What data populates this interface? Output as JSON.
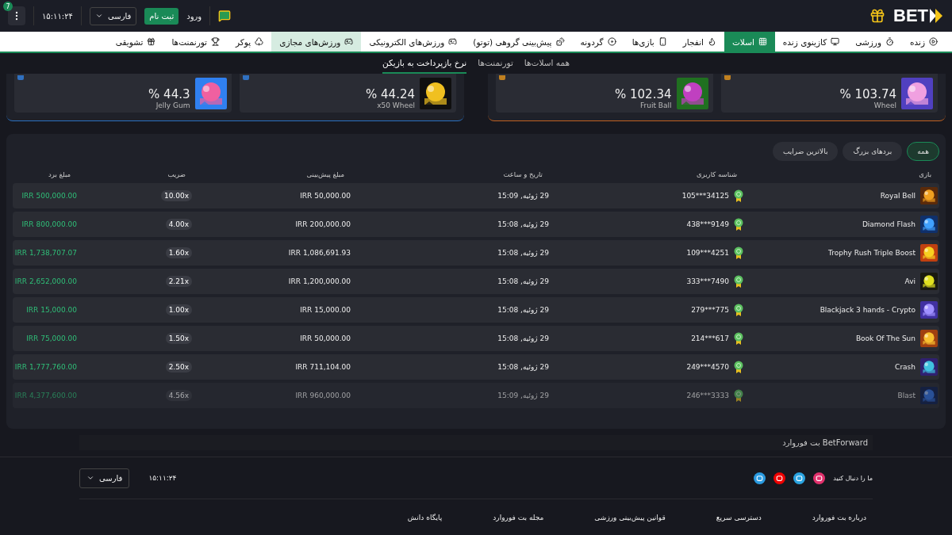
{
  "header": {
    "logo": "BET",
    "login": "ورود",
    "signup": "ثبت نام",
    "language": "فارسی",
    "time": "۱۵:۱۱:۲۴",
    "menu_badge": "7"
  },
  "nav": [
    {
      "label": "زنده",
      "selected": false,
      "hover": false
    },
    {
      "label": "ورزشی",
      "selected": false,
      "hover": false
    },
    {
      "label": "کازینوی زنده",
      "selected": false,
      "hover": false
    },
    {
      "label": "اسلات",
      "selected": true,
      "hover": false
    },
    {
      "label": "انفجار",
      "selected": false,
      "hover": false
    },
    {
      "label": "بازی‌ها",
      "selected": false,
      "hover": false
    },
    {
      "label": "گردونه",
      "selected": false,
      "hover": false
    },
    {
      "label": "پیش‌بینی گروهی (توتو)",
      "selected": false,
      "hover": false
    },
    {
      "label": "ورزش‌های الکترونیکی",
      "selected": false,
      "hover": false
    },
    {
      "label": "ورزش‌های مجازی",
      "selected": false,
      "hover": true
    },
    {
      "label": "پوکر",
      "selected": false,
      "hover": false
    },
    {
      "label": "تورنمنت‌ها",
      "selected": false,
      "hover": false
    },
    {
      "label": "تشویقی",
      "selected": false,
      "hover": false
    }
  ],
  "subtabs": [
    {
      "label": "همه اسلات‌ها",
      "selected": false
    },
    {
      "label": "تورنمنت‌ها",
      "selected": false
    },
    {
      "label": "نرخ بازپرداخت به بازیکن",
      "selected": true
    }
  ],
  "rtp_groups": [
    {
      "cards": [
        {
          "name": "Wheel",
          "rtp": "% 103.74"
        },
        {
          "name": "Fruit Ball",
          "rtp": "% 102.34"
        }
      ]
    },
    {
      "cards": [
        {
          "name": "x50 Wheel",
          "rtp": "% 44.24"
        },
        {
          "name": "Jelly Gum",
          "rtp": "% 44.3"
        }
      ]
    }
  ],
  "filters": [
    {
      "label": "همه",
      "selected": true
    },
    {
      "label": "بردهای بزرگ",
      "selected": false
    },
    {
      "label": "بالاترین ضرایب",
      "selected": false
    }
  ],
  "table": {
    "columns": [
      "بازی",
      "شناسه کاربری",
      "تاریخ و ساعت",
      "مبلغ پیش‌بینی",
      "ضریب",
      "مبلغ برد"
    ],
    "rows": [
      {
        "game": "Royal Bell",
        "user": "34125***105",
        "date": "29 ژوئیه, 15:09",
        "bet": "IRR 50,000.00",
        "multiplier": "10.00x",
        "win": "IRR 500,000.00",
        "faded": false
      },
      {
        "game": "Diamond Flash",
        "user": "9149***438",
        "date": "29 ژوئیه, 15:08",
        "bet": "IRR 200,000.00",
        "multiplier": "4.00x",
        "win": "IRR 800,000.00",
        "faded": false
      },
      {
        "game": "Trophy Rush Triple Boost",
        "user": "4251***109",
        "date": "29 ژوئیه, 15:08",
        "bet": "IRR 1,086,691.93",
        "multiplier": "1.60x",
        "win": "IRR 1,738,707.07",
        "faded": false
      },
      {
        "game": "Avi",
        "user": "7490***333",
        "date": "29 ژوئیه, 15:08",
        "bet": "IRR 1,200,000.00",
        "multiplier": "2.21x",
        "win": "IRR 2,652,000.00",
        "faded": false
      },
      {
        "game": "Blackjack 3 hands - Crypto",
        "user": "775***279",
        "date": "29 ژوئیه, 15:08",
        "bet": "IRR 15,000.00",
        "multiplier": "1.00x",
        "win": "IRR 15,000.00",
        "faded": false
      },
      {
        "game": "Book Of The Sun",
        "user": "617***214",
        "date": "29 ژوئیه, 15:08",
        "bet": "IRR 50,000.00",
        "multiplier": "1.50x",
        "win": "IRR 75,000.00",
        "faded": false
      },
      {
        "game": "Crash",
        "user": "4570***249",
        "date": "29 ژوئیه, 15:08",
        "bet": "IRR 711,104.00",
        "multiplier": "2.50x",
        "win": "IRR 1,777,760.00",
        "faded": false
      },
      {
        "game": "Blast",
        "user": "3333***246",
        "date": "29 ژوئیه, 15:09",
        "bet": "IRR 960,000.00",
        "multiplier": "4.56x",
        "win": "IRR 4,377,600.00",
        "faded": true
      }
    ]
  },
  "footer": {
    "brand": "BetForward بت فوروارد",
    "follow": "ما را دنبال کنید",
    "time": "۱۵:۱۱:۲۴",
    "language": "فارسی",
    "links": [
      "درباره بت فوروارد",
      "دسترسی سریع",
      "قوانین پیش‌بینی ورزشی",
      "مجله بت فوروارد",
      "پایگاه دانش"
    ]
  }
}
